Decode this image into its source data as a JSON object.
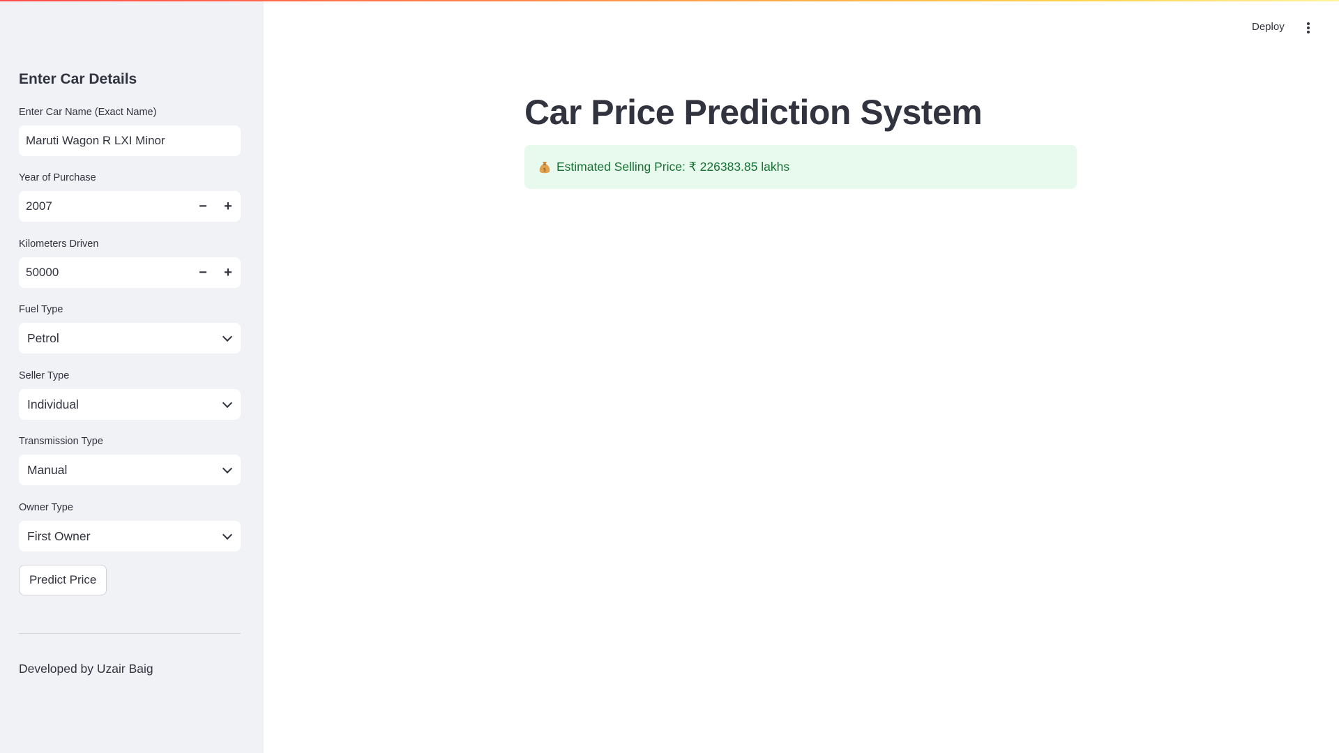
{
  "header": {
    "deploy_label": "Deploy",
    "menu_icon": "kebab-menu-icon"
  },
  "sidebar": {
    "heading": "Enter Car Details",
    "car_name": {
      "label": "Enter Car Name (Exact Name)",
      "value": "Maruti Wagon R LXI Minor"
    },
    "year": {
      "label": "Year of Purchase",
      "value": "2007",
      "minus": "−",
      "plus": "+"
    },
    "km": {
      "label": "Kilometers Driven",
      "value": "50000",
      "minus": "−",
      "plus": "+"
    },
    "fuel": {
      "label": "Fuel Type",
      "value": "Petrol"
    },
    "seller": {
      "label": "Seller Type",
      "value": "Individual"
    },
    "transmission": {
      "label": "Transmission Type",
      "value": "Manual"
    },
    "owner": {
      "label": "Owner Type",
      "value": "First Owner"
    },
    "predict_label": "Predict Price",
    "footer": "Developed by Uzair Baig"
  },
  "main": {
    "title": "Car Price Prediction System",
    "result": "Estimated Selling Price: ₹ 226383.85 lakhs",
    "result_icon": "money-bag-icon"
  },
  "colors": {
    "sidebar_bg": "#f0f2f6",
    "success_bg": "#e8f9ee",
    "success_text": "#177233",
    "text": "#31333f"
  }
}
